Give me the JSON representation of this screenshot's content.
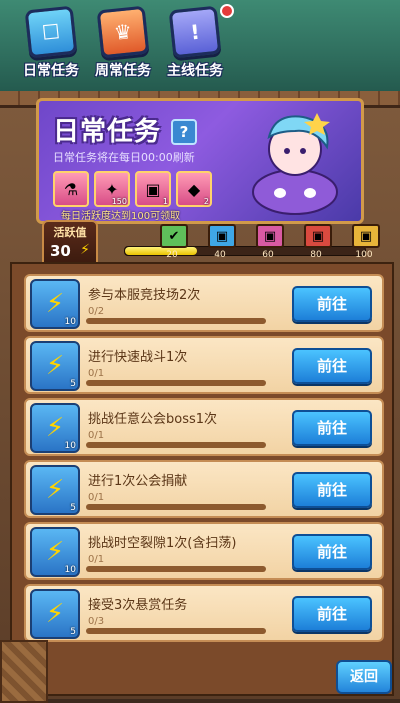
{
  "tabs": [
    {
      "label": "日常任务",
      "icon": "cube-face-icon",
      "active": true
    },
    {
      "label": "周常任务",
      "icon": "crown-face-icon",
      "active": false
    },
    {
      "label": "主线任务",
      "icon": "exclamation-scroll-icon",
      "active": false
    }
  ],
  "banner": {
    "title": "日常任务",
    "help": "?",
    "subtitle": "日常任务将在每日00:00刷新",
    "note": "每日活跃度达到100可领取",
    "rewards": [
      {
        "icon": "potion-icon",
        "count": ""
      },
      {
        "icon": "scroll-icon",
        "count": "150"
      },
      {
        "icon": "chest-icon",
        "count": "1"
      },
      {
        "icon": "gem-icon",
        "count": "2"
      }
    ]
  },
  "activity": {
    "label": "活跃值",
    "value": "30",
    "progress_percent": 30,
    "milestones": [
      {
        "value": "20",
        "icon": "checkmark-chest-icon"
      },
      {
        "value": "40",
        "icon": "blue-chest-icon"
      },
      {
        "value": "60",
        "icon": "pink-chest-icon"
      },
      {
        "value": "80",
        "icon": "red-chest-icon"
      },
      {
        "value": "100",
        "icon": "gold-chest-icon"
      }
    ]
  },
  "tasks": [
    {
      "name": "参与本服竞技场2次",
      "progress": "0/2",
      "reward": "10",
      "button": "前往"
    },
    {
      "name": "进行快速战斗1次",
      "progress": "0/1",
      "reward": "5",
      "button": "前往"
    },
    {
      "name": "挑战任意公会boss1次",
      "progress": "0/1",
      "reward": "10",
      "button": "前往"
    },
    {
      "name": "进行1次公会捐献",
      "progress": "0/1",
      "reward": "5",
      "button": "前往"
    },
    {
      "name": "挑战时空裂隙1次(含扫荡)",
      "progress": "0/1",
      "reward": "10",
      "button": "前往"
    },
    {
      "name": "接受3次悬赏任务",
      "progress": "0/3",
      "reward": "5",
      "button": "前往"
    }
  ],
  "back_label": "返回",
  "colors": {
    "accent": "#2a8ce0",
    "panel": "#f6dcb0",
    "wood": "#7b4a2a"
  }
}
